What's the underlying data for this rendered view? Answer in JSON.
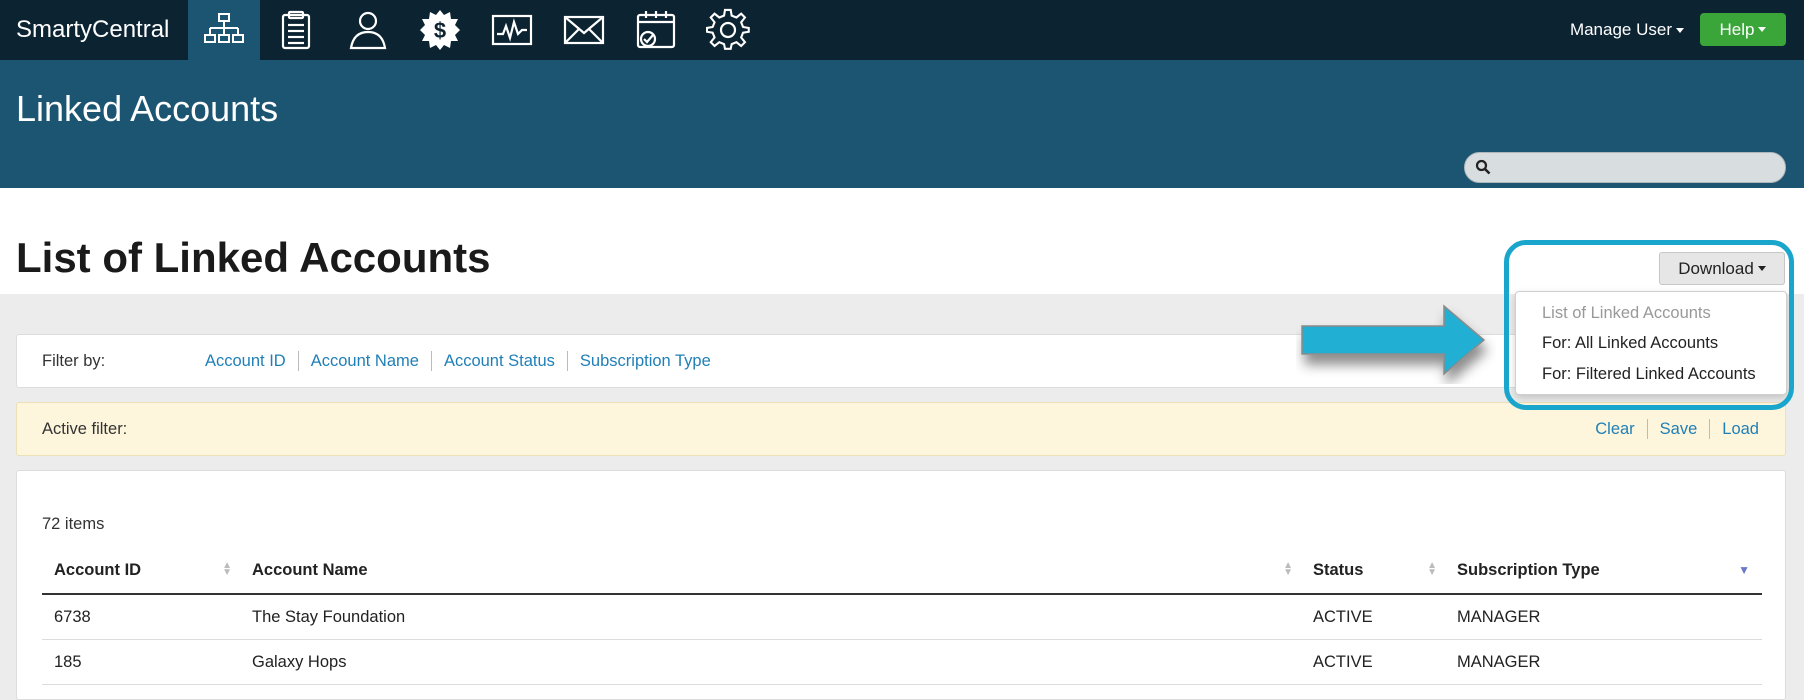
{
  "topnav": {
    "brand": "SmartyCentral",
    "icons": [
      "hierarchy-icon",
      "clipboard-icon",
      "user-icon",
      "dollar-gear-icon",
      "activity-chart-icon",
      "envelope-icon",
      "calendar-check-icon",
      "settings-gear-icon"
    ],
    "manage_user": "Manage User",
    "help": "Help"
  },
  "header": {
    "title": "Linked Accounts",
    "search_placeholder": ""
  },
  "page": {
    "title": "List of Linked Accounts",
    "download_label": "Download",
    "download_menu": {
      "header": "List of Linked Accounts",
      "items": [
        "For: All Linked Accounts",
        "For: Filtered Linked Accounts"
      ]
    }
  },
  "filters": {
    "label": "Filter by:",
    "links": [
      "Account ID",
      "Account Name",
      "Account Status",
      "Subscription Type"
    ]
  },
  "active_filter": {
    "label": "Active filter:",
    "actions": [
      "Clear",
      "Save",
      "Load"
    ]
  },
  "table": {
    "count": "72 items",
    "columns": [
      "Account ID",
      "Account Name",
      "Status",
      "Subscription Type"
    ],
    "rows": [
      [
        "6738",
        "The Stay Foundation",
        "ACTIVE",
        "MANAGER"
      ],
      [
        "185",
        "Galaxy Hops",
        "ACTIVE",
        "MANAGER"
      ]
    ]
  },
  "colors": {
    "nav_bg": "#0c2332",
    "header_bg": "#1b5571",
    "help_green": "#3aa63a",
    "link_blue": "#1f7fb6",
    "highlight": "#1aa6cc"
  }
}
